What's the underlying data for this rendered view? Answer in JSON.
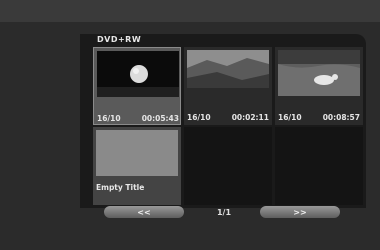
{
  "disc": {
    "type": "DVD+RW"
  },
  "titles": [
    {
      "date": "16/10",
      "duration": "00:05:43",
      "thumbnail": "ball-on-dark-icon",
      "selected": true
    },
    {
      "date": "16/10",
      "duration": "00:02:11",
      "thumbnail": "landscape-icon",
      "selected": false
    },
    {
      "date": "16/10",
      "duration": "00:08:57",
      "thumbnail": "animal-in-field-icon",
      "selected": false
    }
  ],
  "empty_title": {
    "label": "Empty Title"
  },
  "nav": {
    "prev_label": "<<",
    "page": "1/1",
    "next_label": ">>"
  },
  "colors": {
    "background": "#2b2b2b",
    "panel": "#1a1a1a",
    "selected": "#5a5a5a",
    "text": "#e8e8e8"
  }
}
